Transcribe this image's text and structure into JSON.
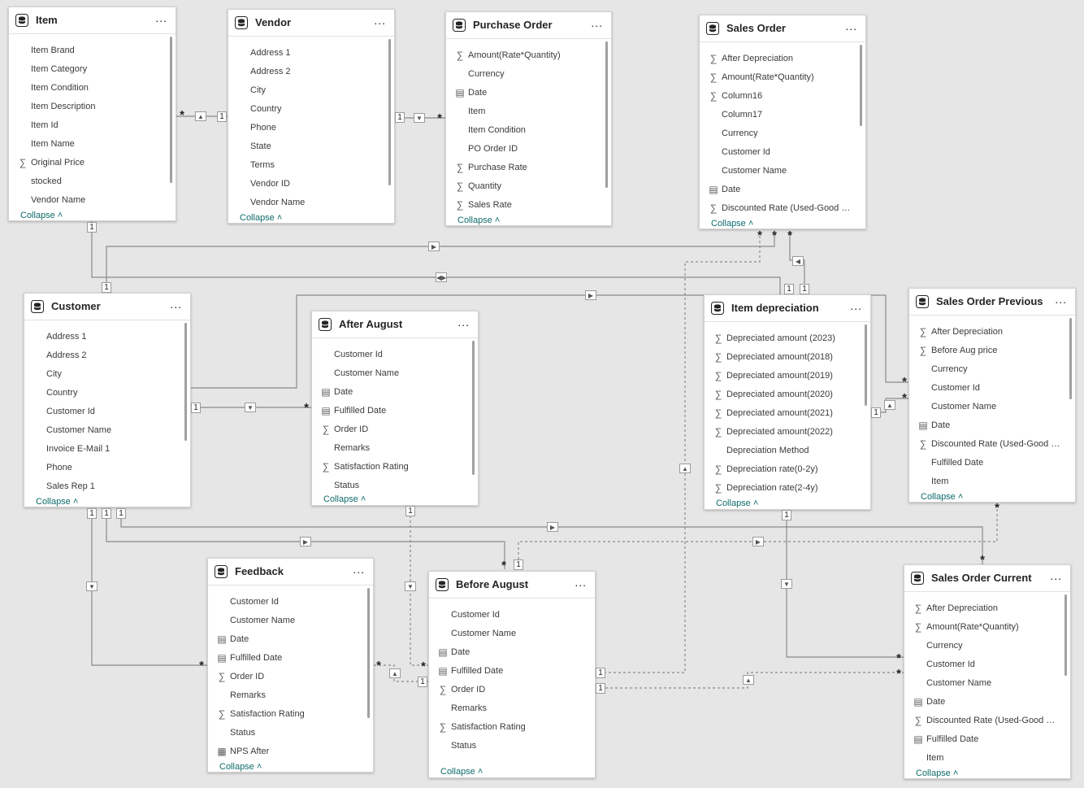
{
  "tables": [
    {
      "id": "item",
      "name": "Item",
      "collapse": "Collapse",
      "fields": [
        {
          "name": "Item Brand",
          "icon": ""
        },
        {
          "name": "Item Category",
          "icon": ""
        },
        {
          "name": "Item Condition",
          "icon": ""
        },
        {
          "name": "Item Description",
          "icon": ""
        },
        {
          "name": "Item Id",
          "icon": ""
        },
        {
          "name": "Item Name",
          "icon": ""
        },
        {
          "name": "Original Price",
          "icon": "sigma"
        },
        {
          "name": "stocked",
          "icon": ""
        },
        {
          "name": "Vendor Name",
          "icon": ""
        }
      ]
    },
    {
      "id": "vendor",
      "name": "Vendor",
      "collapse": "Collapse",
      "fields": [
        {
          "name": "Address 1",
          "icon": ""
        },
        {
          "name": "Address 2",
          "icon": ""
        },
        {
          "name": "City",
          "icon": ""
        },
        {
          "name": "Country",
          "icon": ""
        },
        {
          "name": "Phone",
          "icon": ""
        },
        {
          "name": "State",
          "icon": ""
        },
        {
          "name": "Terms",
          "icon": ""
        },
        {
          "name": "Vendor ID",
          "icon": ""
        },
        {
          "name": "Vendor Name",
          "icon": ""
        }
      ]
    },
    {
      "id": "purchase-order",
      "name": "Purchase Order",
      "collapse": "Collapse",
      "fields": [
        {
          "name": "Amount(Rate*Quantity)",
          "icon": "sigma"
        },
        {
          "name": "Currency",
          "icon": ""
        },
        {
          "name": "Date",
          "icon": "calendar"
        },
        {
          "name": "Item",
          "icon": ""
        },
        {
          "name": "Item Condition",
          "icon": ""
        },
        {
          "name": "PO Order ID",
          "icon": ""
        },
        {
          "name": "Purchase Rate",
          "icon": "sigma"
        },
        {
          "name": "Quantity",
          "icon": "sigma"
        },
        {
          "name": "Sales Rate",
          "icon": "sigma"
        }
      ]
    },
    {
      "id": "sales-order",
      "name": "Sales Order",
      "collapse": "Collapse",
      "fields": [
        {
          "name": "After Depreciation",
          "icon": "sigma"
        },
        {
          "name": "Amount(Rate*Quantity)",
          "icon": "sigma"
        },
        {
          "name": "Column16",
          "icon": "sigma"
        },
        {
          "name": "Column17",
          "icon": ""
        },
        {
          "name": "Currency",
          "icon": ""
        },
        {
          "name": "Customer Id",
          "icon": ""
        },
        {
          "name": "Customer Name",
          "icon": ""
        },
        {
          "name": "Date",
          "icon": "calendar"
        },
        {
          "name": "Discounted Rate (Used-Good pro...",
          "icon": "sigma"
        }
      ]
    },
    {
      "id": "customer",
      "name": "Customer",
      "collapse": "Collapse",
      "fields": [
        {
          "name": "Address 1",
          "icon": ""
        },
        {
          "name": "Address 2",
          "icon": ""
        },
        {
          "name": "City",
          "icon": ""
        },
        {
          "name": "Country",
          "icon": ""
        },
        {
          "name": "Customer Id",
          "icon": ""
        },
        {
          "name": "Customer Name",
          "icon": ""
        },
        {
          "name": "Invoice E-Mail 1",
          "icon": ""
        },
        {
          "name": "Phone",
          "icon": ""
        },
        {
          "name": "Sales Rep 1",
          "icon": ""
        }
      ]
    },
    {
      "id": "after-august",
      "name": "After August",
      "collapse": "Collapse",
      "fields": [
        {
          "name": "Customer Id",
          "icon": ""
        },
        {
          "name": "Customer Name",
          "icon": ""
        },
        {
          "name": "Date",
          "icon": "calendar"
        },
        {
          "name": "Fulfilled Date",
          "icon": "calendar"
        },
        {
          "name": "Order ID",
          "icon": "sigma"
        },
        {
          "name": "Remarks",
          "icon": ""
        },
        {
          "name": "Satisfaction Rating",
          "icon": "sigma"
        },
        {
          "name": "Status",
          "icon": ""
        }
      ]
    },
    {
      "id": "item-depreciation",
      "name": "Item depreciation",
      "collapse": "Collapse",
      "fields": [
        {
          "name": "Depreciated amount (2023)",
          "icon": "sigma"
        },
        {
          "name": "Depreciated amount(2018)",
          "icon": "sigma"
        },
        {
          "name": "Depreciated amount(2019)",
          "icon": "sigma"
        },
        {
          "name": "Depreciated amount(2020)",
          "icon": "sigma"
        },
        {
          "name": "Depreciated amount(2021)",
          "icon": "sigma"
        },
        {
          "name": "Depreciated amount(2022)",
          "icon": "sigma"
        },
        {
          "name": "Depreciation Method",
          "icon": ""
        },
        {
          "name": "Depreciation rate(0-2y)",
          "icon": "sigma"
        },
        {
          "name": "Depreciation rate(2-4y)",
          "icon": "sigma"
        }
      ]
    },
    {
      "id": "sales-order-previous",
      "name": "Sales Order Previous",
      "collapse": "Collapse",
      "fields": [
        {
          "name": "After Depreciation",
          "icon": "sigma"
        },
        {
          "name": "Before Aug price",
          "icon": "sigma"
        },
        {
          "name": "Currency",
          "icon": ""
        },
        {
          "name": "Customer Id",
          "icon": ""
        },
        {
          "name": "Customer Name",
          "icon": ""
        },
        {
          "name": "Date",
          "icon": "calendar"
        },
        {
          "name": "Discounted Rate (Used-Good pro...",
          "icon": "sigma"
        },
        {
          "name": "Fulfilled Date",
          "icon": ""
        },
        {
          "name": "Item",
          "icon": ""
        }
      ]
    },
    {
      "id": "feedback",
      "name": "Feedback",
      "collapse": "Collapse",
      "fields": [
        {
          "name": "Customer Id",
          "icon": ""
        },
        {
          "name": "Customer Name",
          "icon": ""
        },
        {
          "name": "Date",
          "icon": "calendar"
        },
        {
          "name": "Fulfilled Date",
          "icon": "calendar"
        },
        {
          "name": "Order ID",
          "icon": "sigma"
        },
        {
          "name": "Remarks",
          "icon": ""
        },
        {
          "name": "Satisfaction Rating",
          "icon": "sigma"
        },
        {
          "name": "Status",
          "icon": ""
        },
        {
          "name": "NPS After",
          "icon": "calc"
        }
      ]
    },
    {
      "id": "before-august",
      "name": "Before August",
      "collapse": "Collapse",
      "fields": [
        {
          "name": "Customer Id",
          "icon": ""
        },
        {
          "name": "Customer Name",
          "icon": ""
        },
        {
          "name": "Date",
          "icon": "calendar"
        },
        {
          "name": "Fulfilled Date",
          "icon": "calendar"
        },
        {
          "name": "Order ID",
          "icon": "sigma"
        },
        {
          "name": "Remarks",
          "icon": ""
        },
        {
          "name": "Satisfaction Rating",
          "icon": "sigma"
        },
        {
          "name": "Status",
          "icon": ""
        }
      ]
    },
    {
      "id": "sales-order-current",
      "name": "Sales Order Current",
      "collapse": "Collapse",
      "fields": [
        {
          "name": "After Depreciation",
          "icon": "sigma"
        },
        {
          "name": "Amount(Rate*Quantity)",
          "icon": "sigma"
        },
        {
          "name": "Currency",
          "icon": ""
        },
        {
          "name": "Customer Id",
          "icon": ""
        },
        {
          "name": "Customer Name",
          "icon": ""
        },
        {
          "name": "Date",
          "icon": "calendar"
        },
        {
          "name": "Discounted Rate (Used-Good pro...",
          "icon": "sigma"
        },
        {
          "name": "Fulfilled Date",
          "icon": "calendar"
        },
        {
          "name": "Item",
          "icon": ""
        }
      ]
    }
  ],
  "more_label": "...",
  "cardinality": {
    "one": "1",
    "many": "*"
  },
  "colors": {
    "canvas": "#e6e6e6",
    "line": "#8a8a8a",
    "link": "#0e6b6b",
    "card": "#ffffff"
  }
}
